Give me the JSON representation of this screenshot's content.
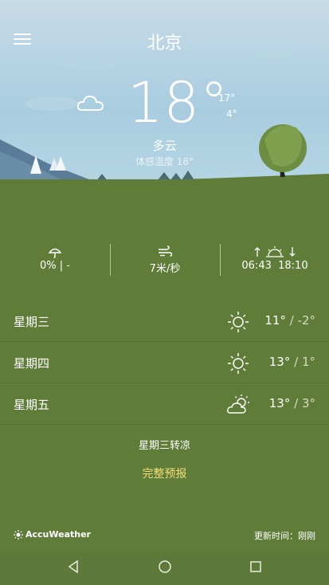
{
  "header": {
    "city": "北京"
  },
  "current": {
    "temperature": "18°",
    "high": "17°",
    "low": "4°",
    "condition": "多云",
    "feels_like": "体感温度 18°"
  },
  "stats": {
    "precipitation": "0% | -",
    "wind": "7米/秒",
    "sunrise": "06:43",
    "sunset": "18:10"
  },
  "forecast": [
    {
      "day": "星期三",
      "icon": "sun-icon",
      "high": "11°",
      "low": "/ -2°"
    },
    {
      "day": "星期四",
      "icon": "sun-icon",
      "high": "13°",
      "low": "/ 1°"
    },
    {
      "day": "星期五",
      "icon": "partly-cloudy-icon",
      "high": "13°",
      "low": "/ 3°"
    }
  ],
  "summary": "星期三转凉",
  "full_forecast_label": "完整预报",
  "footer": {
    "brand": "AccuWeather",
    "updated": "更新时间：刚刚"
  },
  "colors": {
    "sky": "#a9cde0",
    "ground": "#5f7c38",
    "accent": "#f3de7a"
  }
}
